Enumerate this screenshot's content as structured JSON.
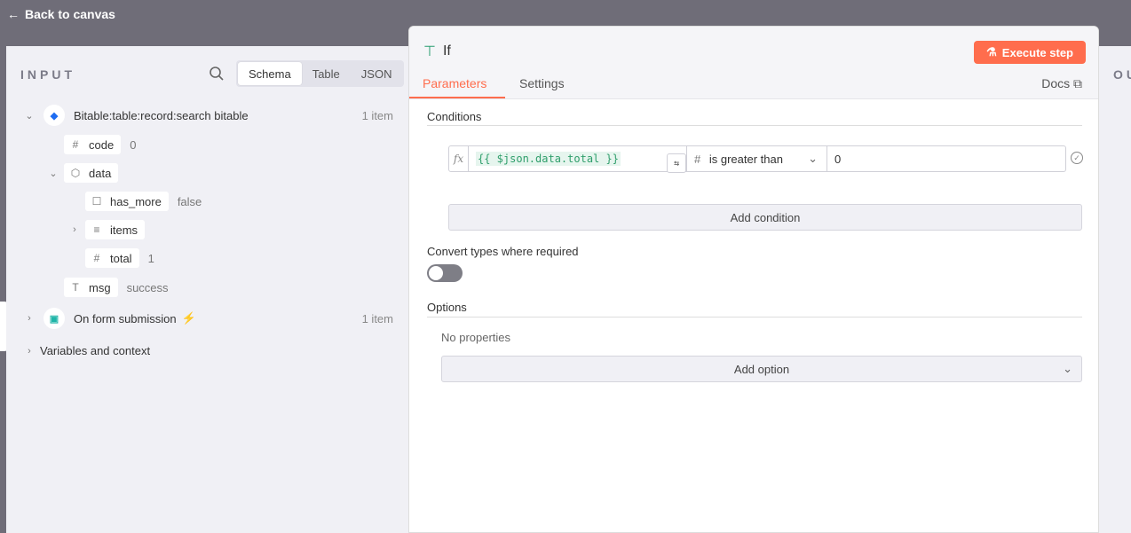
{
  "topbar": {
    "back_label": "Back to canvas"
  },
  "input_panel": {
    "title": "INPUT",
    "view_tabs": [
      "Schema",
      "Table",
      "JSON"
    ],
    "active_view": "Schema",
    "tree": {
      "node1": {
        "label": "Bitable:table:record:search bitable",
        "count": "1 item"
      },
      "code": {
        "key": "code",
        "value": "0"
      },
      "data": {
        "key": "data"
      },
      "has_more": {
        "key": "has_more",
        "value": "false"
      },
      "items": {
        "key": "items"
      },
      "total": {
        "key": "total",
        "value": "1"
      },
      "msg": {
        "key": "msg",
        "value": "success"
      },
      "node2": {
        "label": "On form submission",
        "count": "1 item"
      },
      "vars": {
        "label": "Variables and context"
      }
    }
  },
  "node_panel": {
    "title": "If",
    "execute_label": "Execute step",
    "tabs": {
      "parameters": "Parameters",
      "settings": "Settings"
    },
    "docs_label": "Docs",
    "conditions_label": "Conditions",
    "condition": {
      "fx": "fx",
      "left_value": "{{ $json.data.total }}",
      "operator": "is greater than",
      "right_value": "0"
    },
    "add_condition_label": "Add condition",
    "convert_types_label": "Convert types where required",
    "convert_types_enabled": false,
    "options_label": "Options",
    "no_properties": "No properties",
    "add_option_label": "Add option"
  },
  "output_panel": {
    "title": "OU"
  },
  "colors": {
    "accent": "#ff6d4d",
    "expression": "#2f9e6b"
  }
}
